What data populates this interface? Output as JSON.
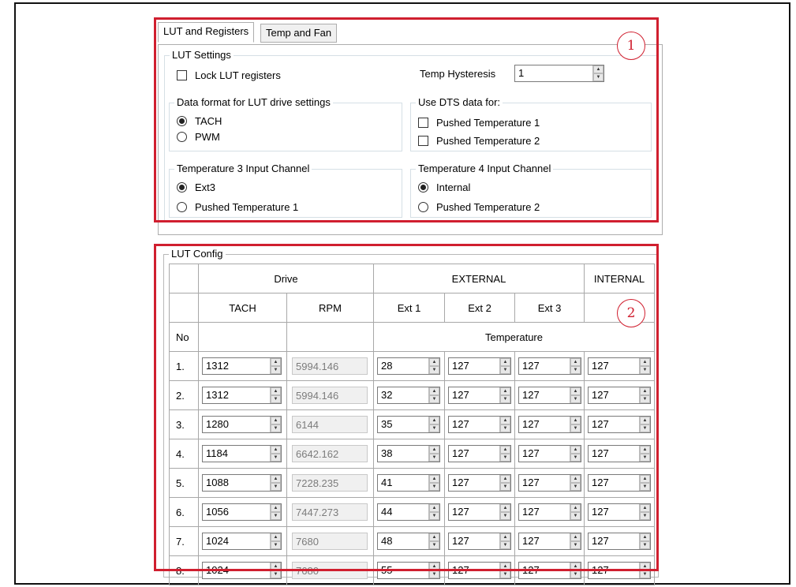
{
  "tabs": [
    {
      "label": "LUT and Registers",
      "active": true
    },
    {
      "label": "Temp and Fan",
      "active": false
    }
  ],
  "lut_settings": {
    "title": "LUT Settings",
    "lock_label": "Lock LUT registers",
    "lock_checked": false,
    "hysteresis_label": "Temp Hysteresis",
    "hysteresis_value": "1"
  },
  "data_format": {
    "title": "Data format for LUT drive settings",
    "options": [
      {
        "label": "TACH",
        "selected": true
      },
      {
        "label": "PWM",
        "selected": false
      }
    ]
  },
  "dts": {
    "title": "Use DTS data for:",
    "options": [
      {
        "label": "Pushed Temperature 1",
        "checked": false
      },
      {
        "label": "Pushed Temperature 2",
        "checked": false
      }
    ]
  },
  "temp3": {
    "title": "Temperature 3 Input Channel",
    "options": [
      {
        "label": "Ext3",
        "selected": true
      },
      {
        "label": "Pushed Temperature 1",
        "selected": false
      }
    ]
  },
  "temp4": {
    "title": "Temperature 4 Input Channel",
    "options": [
      {
        "label": "Internal",
        "selected": true
      },
      {
        "label": "Pushed Temperature 2",
        "selected": false
      }
    ]
  },
  "lut_config": {
    "title": "LUT Config",
    "headers": {
      "drive": "Drive",
      "external": "EXTERNAL",
      "internal": "INTERNAL",
      "tach": "TACH",
      "rpm": "RPM",
      "ext1": "Ext 1",
      "ext2": "Ext 2",
      "ext3": "Ext 3",
      "no": "No",
      "temperature": "Temperature"
    },
    "rows": [
      {
        "no": "1.",
        "tach": "1312",
        "rpm": "5994.146",
        "ext1": "28",
        "ext2": "127",
        "ext3": "127",
        "internal": "127"
      },
      {
        "no": "2.",
        "tach": "1312",
        "rpm": "5994.146",
        "ext1": "32",
        "ext2": "127",
        "ext3": "127",
        "internal": "127"
      },
      {
        "no": "3.",
        "tach": "1280",
        "rpm": "6144",
        "ext1": "35",
        "ext2": "127",
        "ext3": "127",
        "internal": "127"
      },
      {
        "no": "4.",
        "tach": "1184",
        "rpm": "6642.162",
        "ext1": "38",
        "ext2": "127",
        "ext3": "127",
        "internal": "127"
      },
      {
        "no": "5.",
        "tach": "1088",
        "rpm": "7228.235",
        "ext1": "41",
        "ext2": "127",
        "ext3": "127",
        "internal": "127"
      },
      {
        "no": "6.",
        "tach": "1056",
        "rpm": "7447.273",
        "ext1": "44",
        "ext2": "127",
        "ext3": "127",
        "internal": "127"
      },
      {
        "no": "7.",
        "tach": "1024",
        "rpm": "7680",
        "ext1": "48",
        "ext2": "127",
        "ext3": "127",
        "internal": "127"
      },
      {
        "no": "8.",
        "tach": "1024",
        "rpm": "7680",
        "ext1": "55",
        "ext2": "127",
        "ext3": "127",
        "internal": "127"
      }
    ]
  },
  "annotations": {
    "marker1": "1",
    "marker2": "2",
    "highlight_color": "#d01f2f"
  },
  "icons": {
    "spin_up": "spin-up-arrow-icon",
    "spin_down": "spin-down-arrow-icon"
  }
}
